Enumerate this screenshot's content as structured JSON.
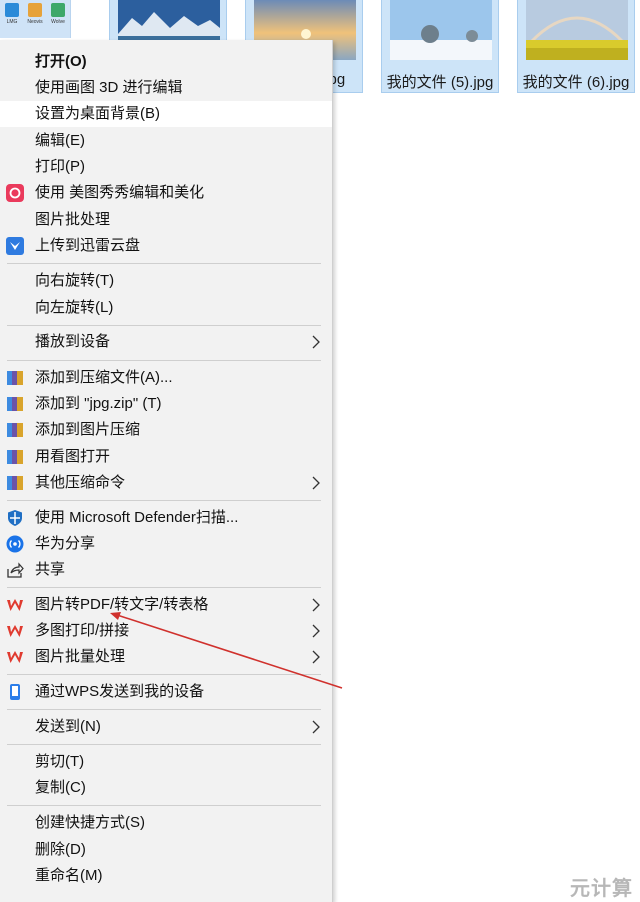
{
  "desktop_icons": [
    {
      "name": "app-icon-1",
      "caption": "LMG"
    },
    {
      "name": "app-icon-2",
      "caption": "Neovis"
    },
    {
      "name": "app-icon-3",
      "caption": "Wolve"
    }
  ],
  "thumbnails": [
    {
      "name": "",
      "partial": true
    },
    {
      "name": ".jpg",
      "partial": true
    },
    {
      "name": "我的文件 (5).jpg"
    },
    {
      "name": "我的文件 (6).jpg"
    }
  ],
  "menu": {
    "items": [
      {
        "label": "打开(O)",
        "bold": true
      },
      {
        "label": "使用画图 3D 进行编辑"
      },
      {
        "label": "设置为桌面背景(B)",
        "highlighted": true
      },
      {
        "label": "编辑(E)"
      },
      {
        "label": "打印(P)"
      },
      {
        "label": "使用 美图秀秀编辑和美化",
        "icon": "meitu-icon"
      },
      {
        "label": "图片批处理"
      },
      {
        "label": "上传到迅雷云盘",
        "icon": "xunlei-icon"
      },
      {
        "label": "向右旋转(T)"
      },
      {
        "label": "向左旋转(L)"
      },
      {
        "label": "播放到设备",
        "submenu": true
      },
      {
        "label": "添加到压缩文件(A)...",
        "icon": "winrar-icon"
      },
      {
        "label": "添加到 \"jpg.zip\" (T)",
        "icon": "winrar-icon"
      },
      {
        "label": "添加到图片压缩",
        "icon": "winrar-icon"
      },
      {
        "label": "用看图打开",
        "icon": "winrar-icon"
      },
      {
        "label": "其他压缩命令",
        "icon": "winrar-icon",
        "submenu": true
      },
      {
        "label": "使用 Microsoft Defender扫描...",
        "icon": "defender-icon"
      },
      {
        "label": "华为分享",
        "icon": "huawei-share-icon"
      },
      {
        "label": "共享",
        "icon": "share-icon"
      },
      {
        "label": "图片转PDF/转文字/转表格",
        "icon": "wps-icon",
        "submenu": true
      },
      {
        "label": "多图打印/拼接",
        "icon": "wps-icon",
        "submenu": true
      },
      {
        "label": "图片批量处理",
        "icon": "wps-icon",
        "submenu": true
      },
      {
        "label": "通过WPS发送到我的设备",
        "icon": "phone-icon"
      },
      {
        "label": "发送到(N)",
        "submenu": true
      },
      {
        "label": "剪切(T)"
      },
      {
        "label": "复制(C)"
      },
      {
        "label": "创建快捷方式(S)"
      },
      {
        "label": "删除(D)"
      },
      {
        "label": "重命名(M)"
      }
    ]
  },
  "annotation": {
    "color": "#d0312d"
  },
  "watermark": "元计算"
}
